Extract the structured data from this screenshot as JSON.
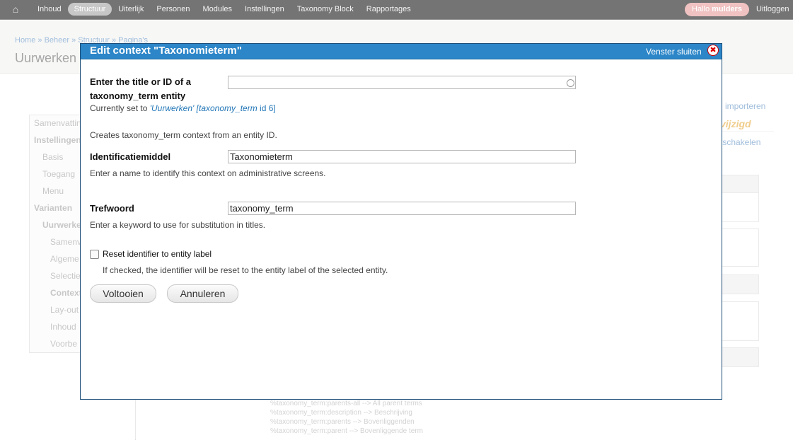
{
  "toolbar": {
    "home_icon": "home-icon",
    "menu": [
      "Inhoud",
      "Structuur",
      "Uiterlijk",
      "Personen",
      "Modules",
      "Instellingen",
      "Taxonomy Block",
      "Rapportages"
    ],
    "active": "Structuur",
    "greeting": "Hallo",
    "username": "mulders",
    "logout": "Uitloggen"
  },
  "background": {
    "breadcrumb": "Home » Beheer » Structuur » Pagina's",
    "page_title": "Uurwerken",
    "sidebar": [
      "Samenvatting",
      "Instellingen",
      "Basis",
      "Toegang",
      "Menu",
      "Varianten",
      "Uurwerken",
      "Samenv",
      "Algeme",
      "Selectie",
      "Context",
      "Lay-out",
      "Inhoud",
      "Voorbe"
    ],
    "right_links": [
      "importeren",
      "vijzigd",
      "tschakelen"
    ],
    "tokens": [
      "%taxonomy_term:parents-all --> All parent terms",
      "%taxonomy_term:description --> Beschrijving",
      "%taxonomy_term:parents --> Bovenliggenden",
      "%taxonomy_term:parent --> Bovenliggende term"
    ]
  },
  "modal": {
    "title": "Edit context \"Taxonomieterm\"",
    "close_label": "Venster sluiten",
    "entity_label_line1": "Enter the title or ID of a",
    "entity_label_line2": "taxonomy_term entity",
    "currently_set_prefix": "Currently set to ",
    "currently_set_name": "'Uurwerken'",
    "currently_set_type": "[taxonomy_term",
    "currently_set_id": " id 6]",
    "entity_value": "",
    "creates_text": "Creates taxonomy_term context from an entity ID.",
    "identifier_label": "Identificatiemiddel",
    "identifier_value": "Taxonomieterm",
    "identifier_help": "Enter a name to identify this context on administrative screens.",
    "keyword_label": "Trefwoord",
    "keyword_value": "taxonomy_term",
    "keyword_help": "Enter a keyword to use for substitution in titles.",
    "reset_label": "Reset identifier to entity label",
    "reset_checked": false,
    "reset_help": "If checked, the identifier will be reset to the entity label of the selected entity.",
    "finish_button": "Voltooien",
    "cancel_button": "Annuleren"
  }
}
